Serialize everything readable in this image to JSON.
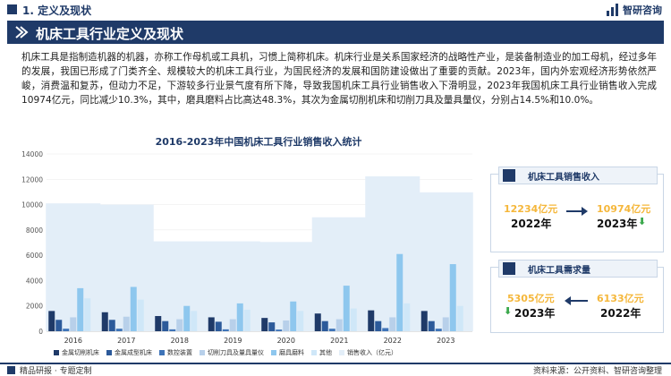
{
  "header": {
    "section_title": "1. 定义及现状",
    "logo_text": "智研咨询",
    "banner_title": "机床工具行业定义及现状"
  },
  "description": "机床工具是指制造机器的机器，亦称工作母机或工具机，习惯上简称机床。机床行业是关系国家经济的战略性产业，是装备制造业的加工母机，经过多年的发展，我国已形成了门类齐全、规模较大的机床工具行业，为国民经济的发展和国防建设做出了重要的贡献。2023年，国内外宏观经济形势依然严峻，消费温和复苏，但动力不足，下游较多行业景气度有所下降，导致我国机床工具行业销售收入下滑明显，2023年我国机床工具行业销售收入完成10974亿元，同比减少10.3%，其中，磨具磨料占比高达48.3%，其次为金属切削机床和切削刀具及量具量仪，分别占14.5%和10.0%。",
  "chart_data": {
    "type": "bar",
    "title": "2016-2023年中国机床工具行业销售收入统计",
    "categories": [
      "2016",
      "2017",
      "2018",
      "2019",
      "2020",
      "2021",
      "2022",
      "2023"
    ],
    "ylim": [
      0,
      14000
    ],
    "yticks": [
      0,
      2000,
      4000,
      6000,
      8000,
      10000,
      12000,
      14000
    ],
    "series": [
      {
        "name": "金属切削机床",
        "color": "#1f3a68",
        "values": [
          1600,
          1500,
          1200,
          1100,
          1050,
          1400,
          1650,
          1600
        ]
      },
      {
        "name": "金属成型机床",
        "color": "#2c5a9a",
        "values": [
          900,
          900,
          800,
          750,
          700,
          800,
          800,
          800
        ]
      },
      {
        "name": "数控装置",
        "color": "#3f74b8",
        "values": [
          200,
          200,
          150,
          150,
          130,
          200,
          250,
          200
        ]
      },
      {
        "name": "切削刀具及量具量仪",
        "color": "#b8d0ea",
        "values": [
          1100,
          1150,
          950,
          950,
          850,
          950,
          1100,
          1100
        ]
      },
      {
        "name": "磨具磨料",
        "color": "#8ec7ee",
        "values": [
          3400,
          3500,
          2000,
          2200,
          2350,
          3600,
          6100,
          5300
        ]
      },
      {
        "name": "其他",
        "color": "#cfe7f8",
        "values": [
          2600,
          2500,
          1600,
          1700,
          1600,
          1800,
          2200,
          2000
        ]
      },
      {
        "name": "销售收入（亿元）",
        "color": "#e3eef8",
        "values": [
          10100,
          10000,
          7100,
          7100,
          7050,
          9000,
          12234,
          10974
        ]
      }
    ]
  },
  "cards": {
    "sales": {
      "title": "机床工具销售收入",
      "prev_value": "12234亿元",
      "prev_year": "2022年",
      "curr_value": "10974亿元",
      "curr_year": "2023年",
      "trend_icon": "down-arrow-icon"
    },
    "demand": {
      "title": "机床工具需求量",
      "left_value": "5305亿元",
      "left_year": "2023年",
      "right_value": "6133亿元",
      "right_year": "2022年",
      "trend_icon": "down-arrow-icon"
    }
  },
  "footer": {
    "left": "精品研报 · 专题定制",
    "right": "资料来源：公开资料、智研咨询整理"
  }
}
